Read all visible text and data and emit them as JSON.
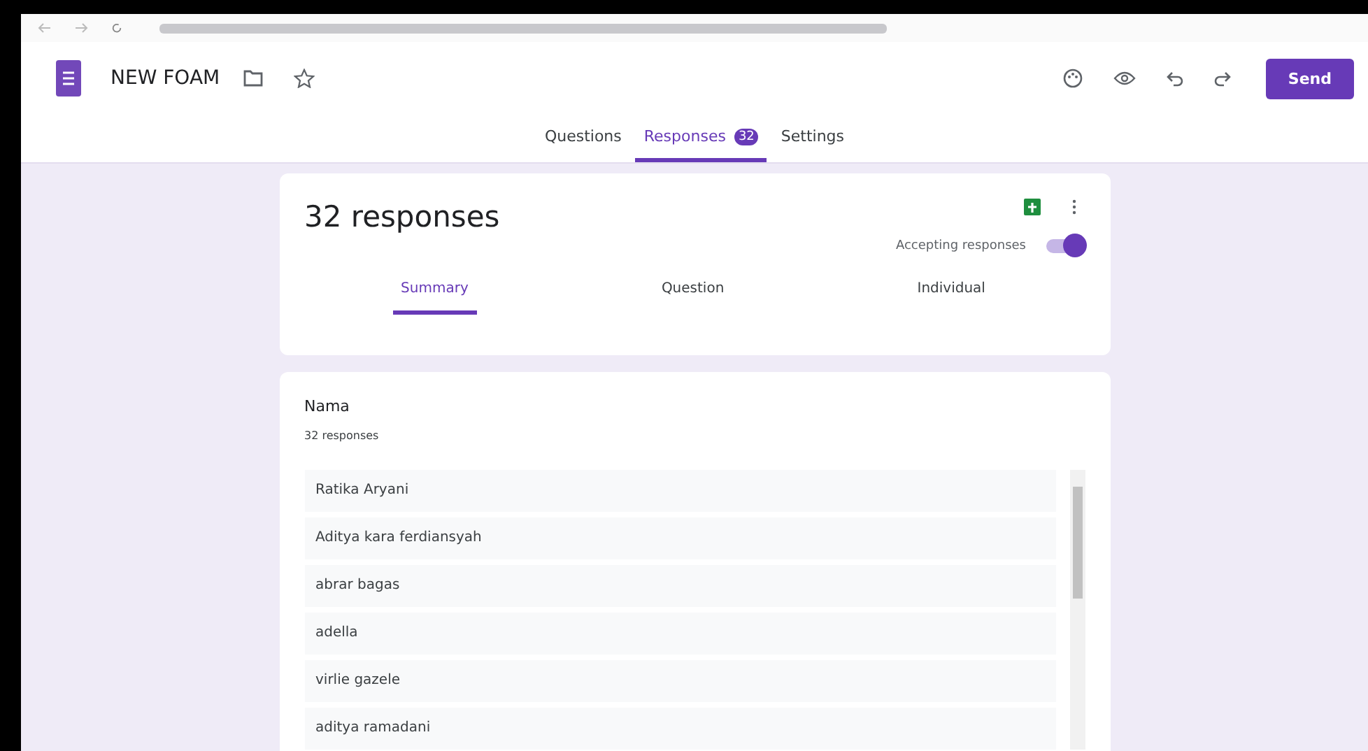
{
  "header": {
    "title": "NEW FOAM",
    "send_label": "Send"
  },
  "tabs": [
    {
      "label": "Questions",
      "selected": false
    },
    {
      "label": "Responses",
      "selected": true,
      "badge": "32"
    },
    {
      "label": "Settings",
      "selected": false
    }
  ],
  "summary_card": {
    "title": "32 responses",
    "accepting_label": "Accepting responses",
    "accepting": true,
    "views": [
      {
        "label": "Summary",
        "selected": true
      },
      {
        "label": "Question",
        "selected": false
      },
      {
        "label": "Individual",
        "selected": false
      }
    ]
  },
  "question_card": {
    "title": "Nama",
    "count": "32 responses",
    "answers": [
      "Ratika Aryani",
      "Aditya kara ferdiansyah",
      "abrar bagas",
      "adella",
      "virlie gazele",
      "aditya ramadani"
    ]
  }
}
